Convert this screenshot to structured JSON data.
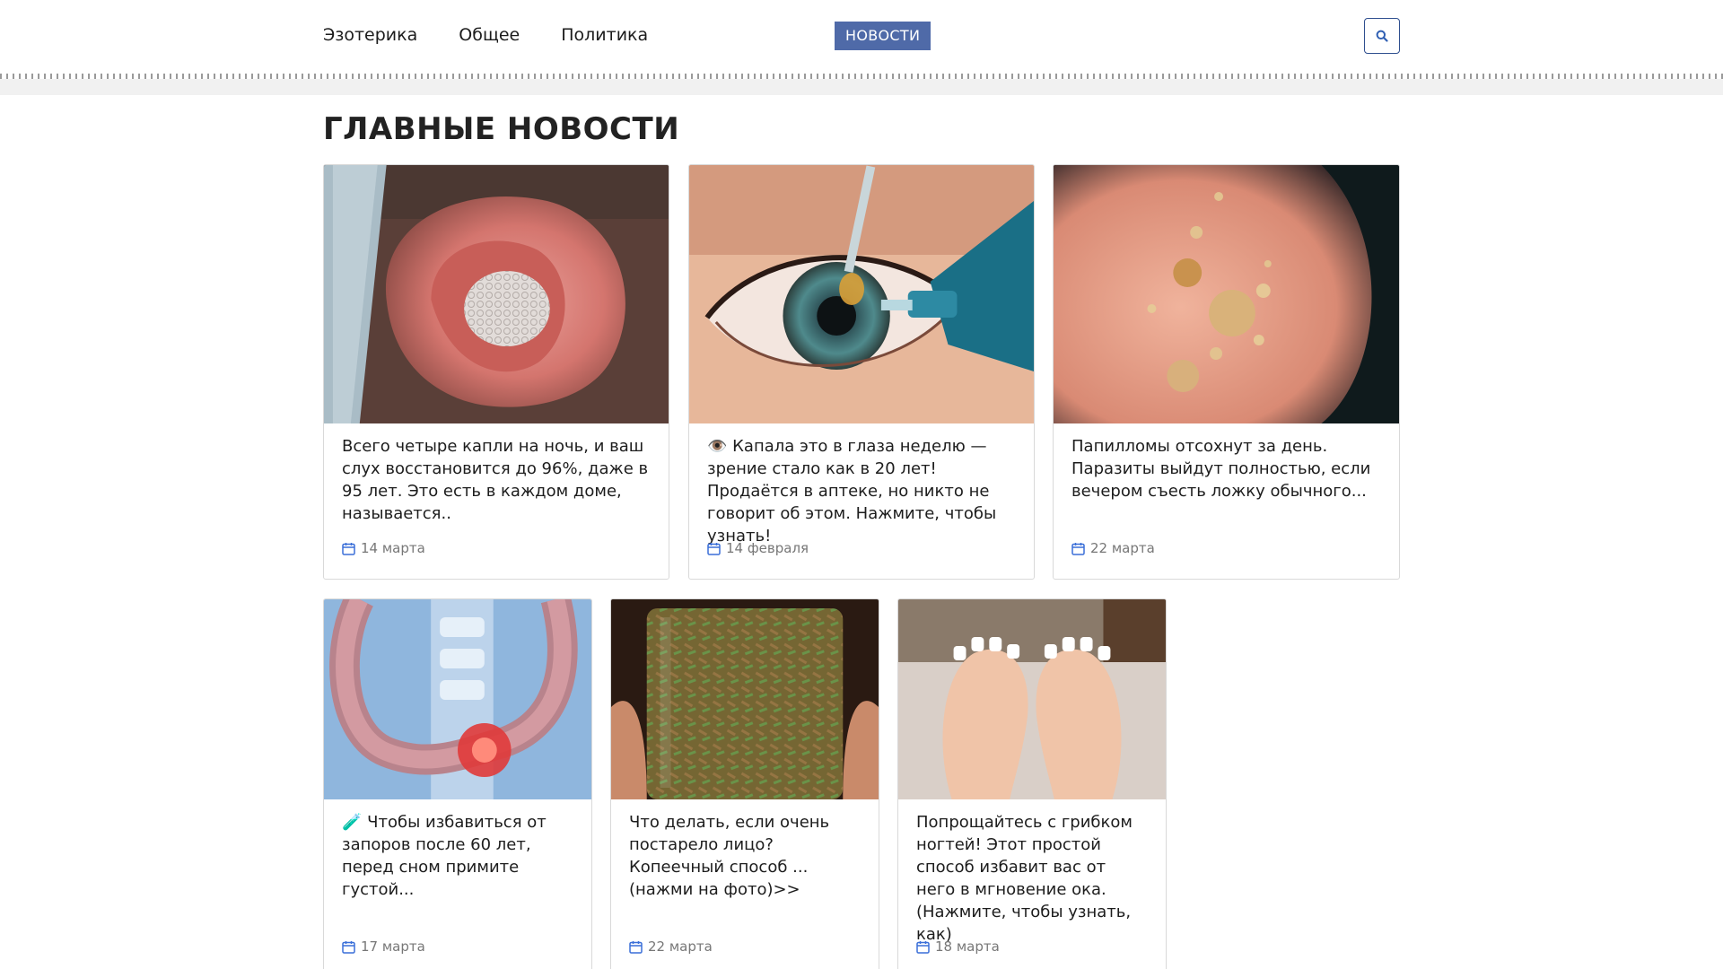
{
  "nav": {
    "items": [
      {
        "label": "Эзотерика"
      },
      {
        "label": "Общее"
      },
      {
        "label": "Политика"
      }
    ],
    "badge": "НОВОСТИ",
    "search_icon": "search-icon"
  },
  "section": {
    "title": "ГЛАВНЫЕ НОВОСТИ"
  },
  "cards": [
    {
      "title": "Всего четыре капли на ночь, и ваш слух восстановится до 96%, даже в 95 лет. Это есть в каждом доме, называется..",
      "date": "14 марта",
      "image": "ear-photo"
    },
    {
      "title": "👁️ Капала это в глаза неделю — зрение стало как в 20 лет! Продаётся в аптеке, но никто не говорит об этом. Нажмите, чтобы узнать!",
      "date": "14 февраля",
      "image": "eye-drops-photo"
    },
    {
      "title": "Папилломы отсохнут за день. Паразиты выйдут полностью, если вечером съесть ложку обычного...",
      "date": "22 марта",
      "image": "papilloma-skin-photo"
    },
    {
      "title": "🧪 Чтобы избавиться от запоров после 60 лет, перед сном примите густой...",
      "date": "17 марта",
      "image": "colon-illustration"
    },
    {
      "title": "Что делать, если очень постарело лицо? Копеечный способ ...(нажми на фото)>>",
      "date": "22 марта",
      "image": "cloves-jar-photo"
    },
    {
      "title": "Попрощайтесь с грибком ногтей! Этот простой способ избавит вас от него в мгновение ока. (Нажмите, чтобы узнать, как)",
      "date": "18 марта",
      "image": "feet-photo"
    }
  ],
  "colors": {
    "accent": "#4f6aa8",
    "search_border": "#2f4f8f",
    "date_icon": "#3a6fd8"
  }
}
